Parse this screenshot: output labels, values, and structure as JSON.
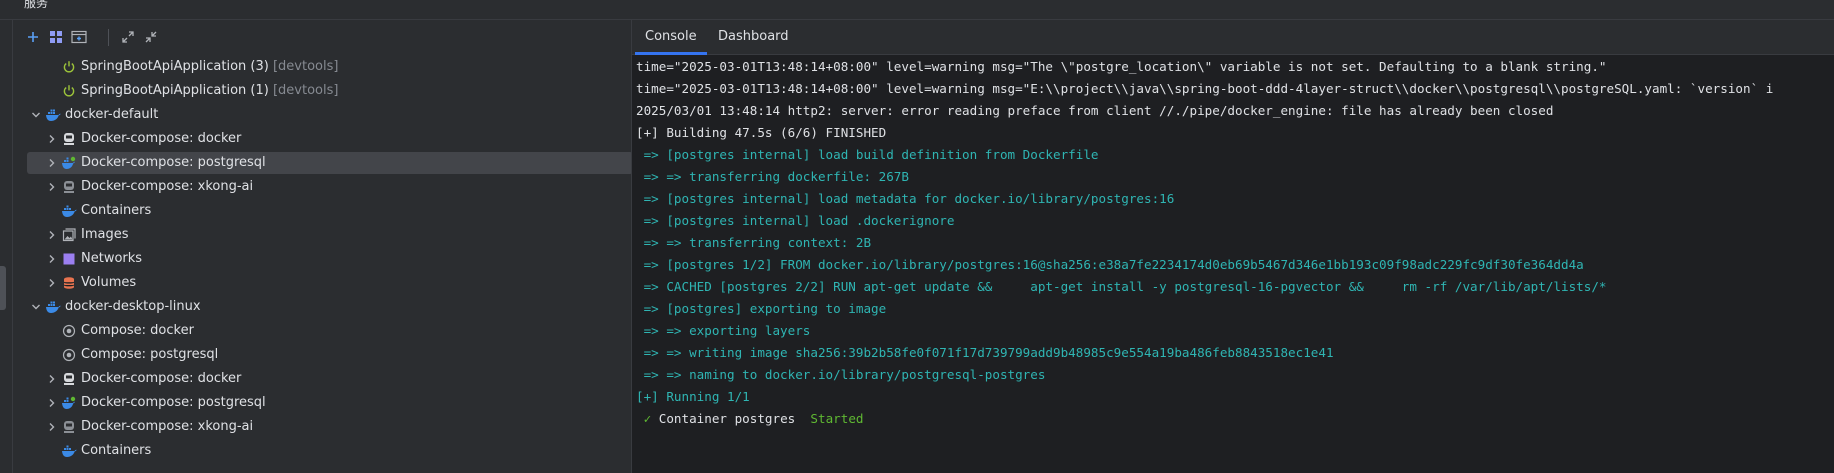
{
  "window": {
    "title": "服务"
  },
  "toolbar": {
    "add": "add-icon",
    "group": "group-icon",
    "new_tab": "new-tab-icon",
    "expand": "expand-all-icon",
    "collapse": "collapse-all-icon"
  },
  "tree": [
    {
      "label": "SpringBootApiApplication (3)",
      "hint": "[devtools]",
      "level": 2,
      "chevron": "none",
      "icon": "power-icon"
    },
    {
      "label": "SpringBootApiApplication (1)",
      "hint": "[devtools]",
      "level": 2,
      "chevron": "none",
      "icon": "power-icon"
    },
    {
      "label": "docker-default",
      "hint": "",
      "level": 1,
      "chevron": "down",
      "icon": "docker-icon"
    },
    {
      "label": "Docker-compose: docker",
      "hint": "",
      "level": 2,
      "chevron": "right",
      "icon": "compose-icon"
    },
    {
      "label": "Docker-compose: postgresql",
      "hint": "",
      "level": 2,
      "chevron": "right",
      "icon": "compose-running-icon",
      "selected": true
    },
    {
      "label": "Docker-compose: xkong-ai",
      "hint": "",
      "level": 2,
      "chevron": "right",
      "icon": "compose-dim-icon"
    },
    {
      "label": "Containers",
      "hint": "",
      "level": 2,
      "chevron": "none",
      "icon": "containers-icon"
    },
    {
      "label": "Images",
      "hint": "",
      "level": 2,
      "chevron": "right",
      "icon": "images-icon"
    },
    {
      "label": "Networks",
      "hint": "",
      "level": 2,
      "chevron": "right",
      "icon": "networks-icon"
    },
    {
      "label": "Volumes",
      "hint": "",
      "level": 2,
      "chevron": "right",
      "icon": "volumes-icon"
    },
    {
      "label": "docker-desktop-linux",
      "hint": "",
      "level": 1,
      "chevron": "down",
      "icon": "docker-icon"
    },
    {
      "label": "Compose: docker",
      "hint": "",
      "level": 2,
      "chevron": "none",
      "icon": "compose-group-icon"
    },
    {
      "label": "Compose: postgresql",
      "hint": "",
      "level": 2,
      "chevron": "none",
      "icon": "compose-group-icon"
    },
    {
      "label": "Docker-compose: docker",
      "hint": "",
      "level": 2,
      "chevron": "right",
      "icon": "compose-icon"
    },
    {
      "label": "Docker-compose: postgresql",
      "hint": "",
      "level": 2,
      "chevron": "right",
      "icon": "compose-running-icon"
    },
    {
      "label": "Docker-compose: xkong-ai",
      "hint": "",
      "level": 2,
      "chevron": "right",
      "icon": "compose-dim-icon"
    },
    {
      "label": "Containers",
      "hint": "",
      "level": 2,
      "chevron": "none",
      "icon": "containers-icon"
    }
  ],
  "tabs": [
    {
      "label": "Console",
      "active": true
    },
    {
      "label": "Dashboard",
      "active": false
    }
  ],
  "colors": {
    "accent": "#3574f0",
    "console_cyan": "#2fb5b3",
    "console_green": "#5fb832",
    "selection": "#43454a"
  },
  "console": [
    {
      "parts": [
        {
          "text": "time=\"2025-03-01T13:48:14+08:00\" level=warning msg=\"The \\\"postgre_location\\\" variable is not set. Defaulting to a blank string.\"",
          "color": "w"
        }
      ]
    },
    {
      "parts": [
        {
          "text": "time=\"2025-03-01T13:48:14+08:00\" level=warning msg=\"E:\\\\project\\\\java\\\\spring-boot-ddd-4layer-struct\\\\docker\\\\postgresql\\\\postgreSQL.yaml: `version` i",
          "color": "w"
        }
      ]
    },
    {
      "parts": [
        {
          "text": "2025/03/01 13:48:14 http2: server: error reading preface from client //./pipe/docker_engine: file has already been closed",
          "color": "w"
        }
      ]
    },
    {
      "parts": [
        {
          "text": "[+] Building 47.5s (6/6) FINISHED",
          "color": "w"
        }
      ]
    },
    {
      "parts": [
        {
          "text": " => [postgres internal] load build definition from Dockerfile",
          "color": "c"
        }
      ]
    },
    {
      "parts": [
        {
          "text": " => => transferring dockerfile: 267B",
          "color": "c"
        }
      ]
    },
    {
      "parts": [
        {
          "text": " => [postgres internal] load metadata for docker.io/library/postgres:16",
          "color": "c"
        }
      ]
    },
    {
      "parts": [
        {
          "text": " => [postgres internal] load .dockerignore",
          "color": "c"
        }
      ]
    },
    {
      "parts": [
        {
          "text": " => => transferring context: 2B",
          "color": "c"
        }
      ]
    },
    {
      "parts": [
        {
          "text": " => [postgres 1/2] FROM docker.io/library/postgres:16@sha256:e38a7fe2234174d0eb69b5467d346e1bb193c09f98adc229fc9df30fe364dd4a",
          "color": "c"
        }
      ]
    },
    {
      "parts": [
        {
          "text": " => CACHED [postgres 2/2] RUN apt-get update &&     apt-get install -y postgresql-16-pgvector &&     rm -rf /var/lib/apt/lists/*",
          "color": "c"
        }
      ]
    },
    {
      "parts": [
        {
          "text": " => [postgres] exporting to image",
          "color": "c"
        }
      ]
    },
    {
      "parts": [
        {
          "text": " => => exporting layers",
          "color": "c"
        }
      ]
    },
    {
      "parts": [
        {
          "text": " => => writing image sha256:39b2b58fe0f071f17d739799add9b48985c9e554a19ba486feb8843518ec1e41",
          "color": "c"
        }
      ]
    },
    {
      "parts": [
        {
          "text": " => => naming to docker.io/library/postgresql-postgres",
          "color": "c"
        }
      ]
    },
    {
      "parts": [
        {
          "text": "[+] Running 1/1",
          "color": "c"
        }
      ]
    },
    {
      "parts": [
        {
          "text": " ✓ ",
          "color": "g"
        },
        {
          "text": "Container postgres  ",
          "color": "w"
        },
        {
          "text": "Started",
          "color": "g"
        }
      ]
    }
  ]
}
